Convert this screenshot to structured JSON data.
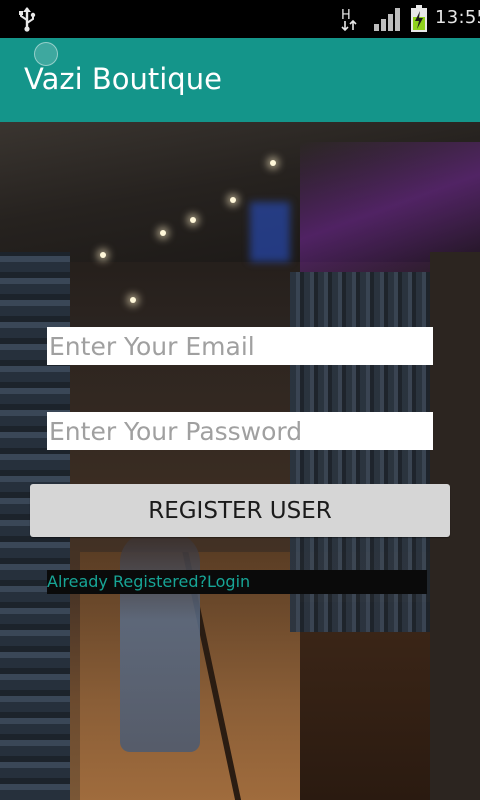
{
  "status_bar": {
    "time": "13:55",
    "network_type": "H",
    "icons": [
      "usb-icon",
      "network-h-icon",
      "signal-icon",
      "battery-charging-icon"
    ]
  },
  "app_bar": {
    "title": "Vazi Boutique",
    "color": "#14958a"
  },
  "form": {
    "email": {
      "placeholder": "Enter Your Email",
      "value": ""
    },
    "password": {
      "placeholder": "Enter Your Password",
      "value": ""
    },
    "register_label": "REGISTER USER",
    "login_link": "Already Registered?Login"
  },
  "colors": {
    "accent": "#14958a",
    "link": "#17a596",
    "button_bg": "#d6d6d6"
  }
}
